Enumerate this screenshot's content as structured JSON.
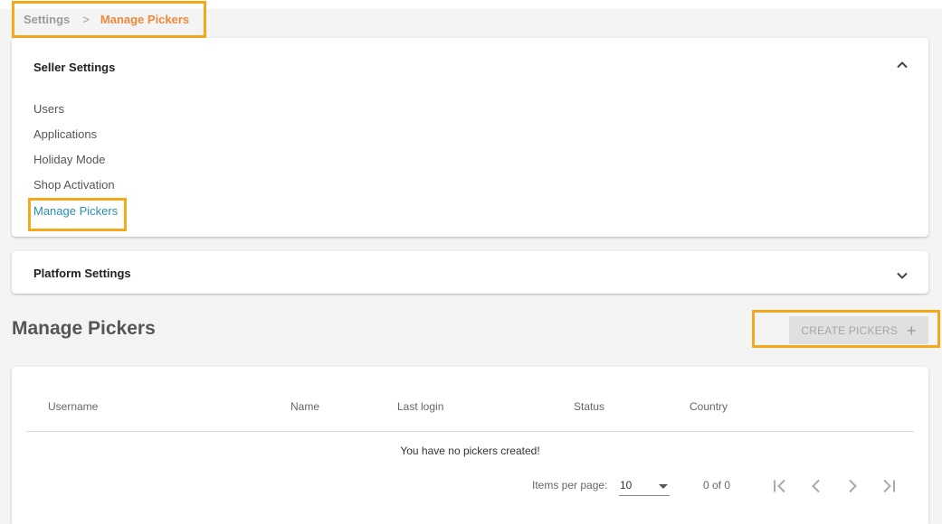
{
  "breadcrumb": {
    "root": "Settings",
    "separator": ">",
    "current": "Manage Pickers"
  },
  "seller_settings": {
    "title": "Seller Settings",
    "items": [
      {
        "label": "Users"
      },
      {
        "label": "Applications"
      },
      {
        "label": "Holiday Mode"
      },
      {
        "label": "Shop Activation"
      },
      {
        "label": "Manage Pickers"
      }
    ],
    "expanded": true
  },
  "platform_settings": {
    "title": "Platform Settings",
    "expanded": false
  },
  "main": {
    "title": "Manage Pickers",
    "create_button": "CREATE PICKERS"
  },
  "table": {
    "columns": [
      "Username",
      "Name",
      "Last login",
      "Status",
      "Country"
    ],
    "empty_message": "You have no pickers created!",
    "paginator": {
      "items_per_page_label": "Items per page:",
      "items_per_page": "10",
      "range": "0 of 0"
    }
  },
  "colors": {
    "highlight": "#f4a91b",
    "breadcrumb_current": "#f0883a",
    "active_link": "#2a8fb5"
  },
  "icons": {
    "seller_chevron": "chevron-up-icon",
    "platform_chevron": "chevron-down-icon",
    "create": "plus-icon",
    "first": "first-page-icon",
    "prev": "chevron-left-icon",
    "next": "chevron-right-icon",
    "last": "last-page-icon"
  }
}
